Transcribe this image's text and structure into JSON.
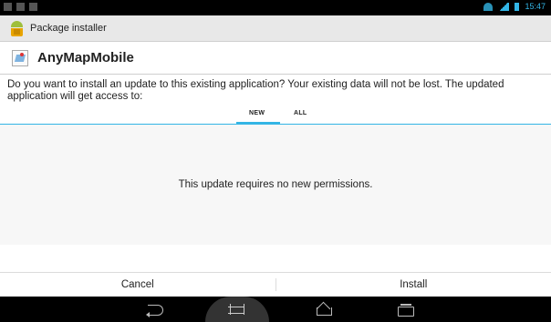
{
  "status_bar": {
    "time": "15:47",
    "icons": [
      "notification-icon",
      "notification-icon",
      "alert-icon",
      "wifi-icon",
      "signal-icon",
      "battery-icon"
    ]
  },
  "action_bar": {
    "title": "Package installer",
    "icon": "android-package-icon"
  },
  "app_header": {
    "name": "AnyMapMobile",
    "icon": "map-app-icon"
  },
  "message": "Do you want to install an update to this existing application? Your existing data will not be lost. The updated application will get access to:",
  "tabs": [
    {
      "label": "NEW",
      "selected": true
    },
    {
      "label": "ALL",
      "selected": false
    }
  ],
  "permissions_text": "This update requires no new permissions.",
  "buttons": {
    "cancel": "Cancel",
    "install": "Install"
  },
  "nav_bar": {
    "icons": [
      "back-icon",
      "fit-screen-icon",
      "home-icon",
      "recent-apps-icon"
    ]
  },
  "colors": {
    "accent": "#33b5e5",
    "action_bar_bg": "#e8e8e8",
    "content_bg": "#f7f7f7"
  }
}
